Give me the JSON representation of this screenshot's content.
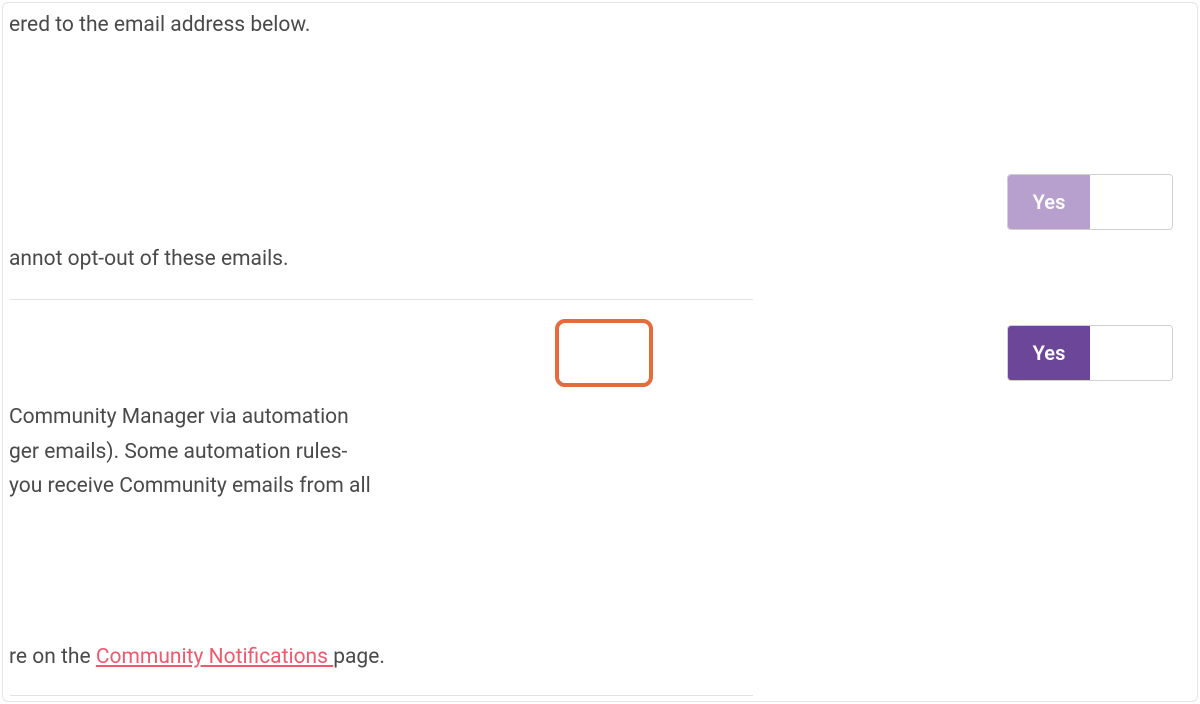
{
  "intro_fragment": "ered to the email address below.",
  "toggles": {
    "system_emails": {
      "yes": "Yes",
      "no": ""
    },
    "community_emails": {
      "yes": "Yes",
      "no": ""
    }
  },
  "desc_system_fragment": "annot opt-out of these emails.",
  "desc_community_fragments": [
    "Community Manager via automation",
    "ger emails). Some automation rules-",
    "you receive Community emails from all"
  ],
  "footer": {
    "prefix": "re on the ",
    "link_label": "Community Notifications ",
    "suffix": "page."
  }
}
